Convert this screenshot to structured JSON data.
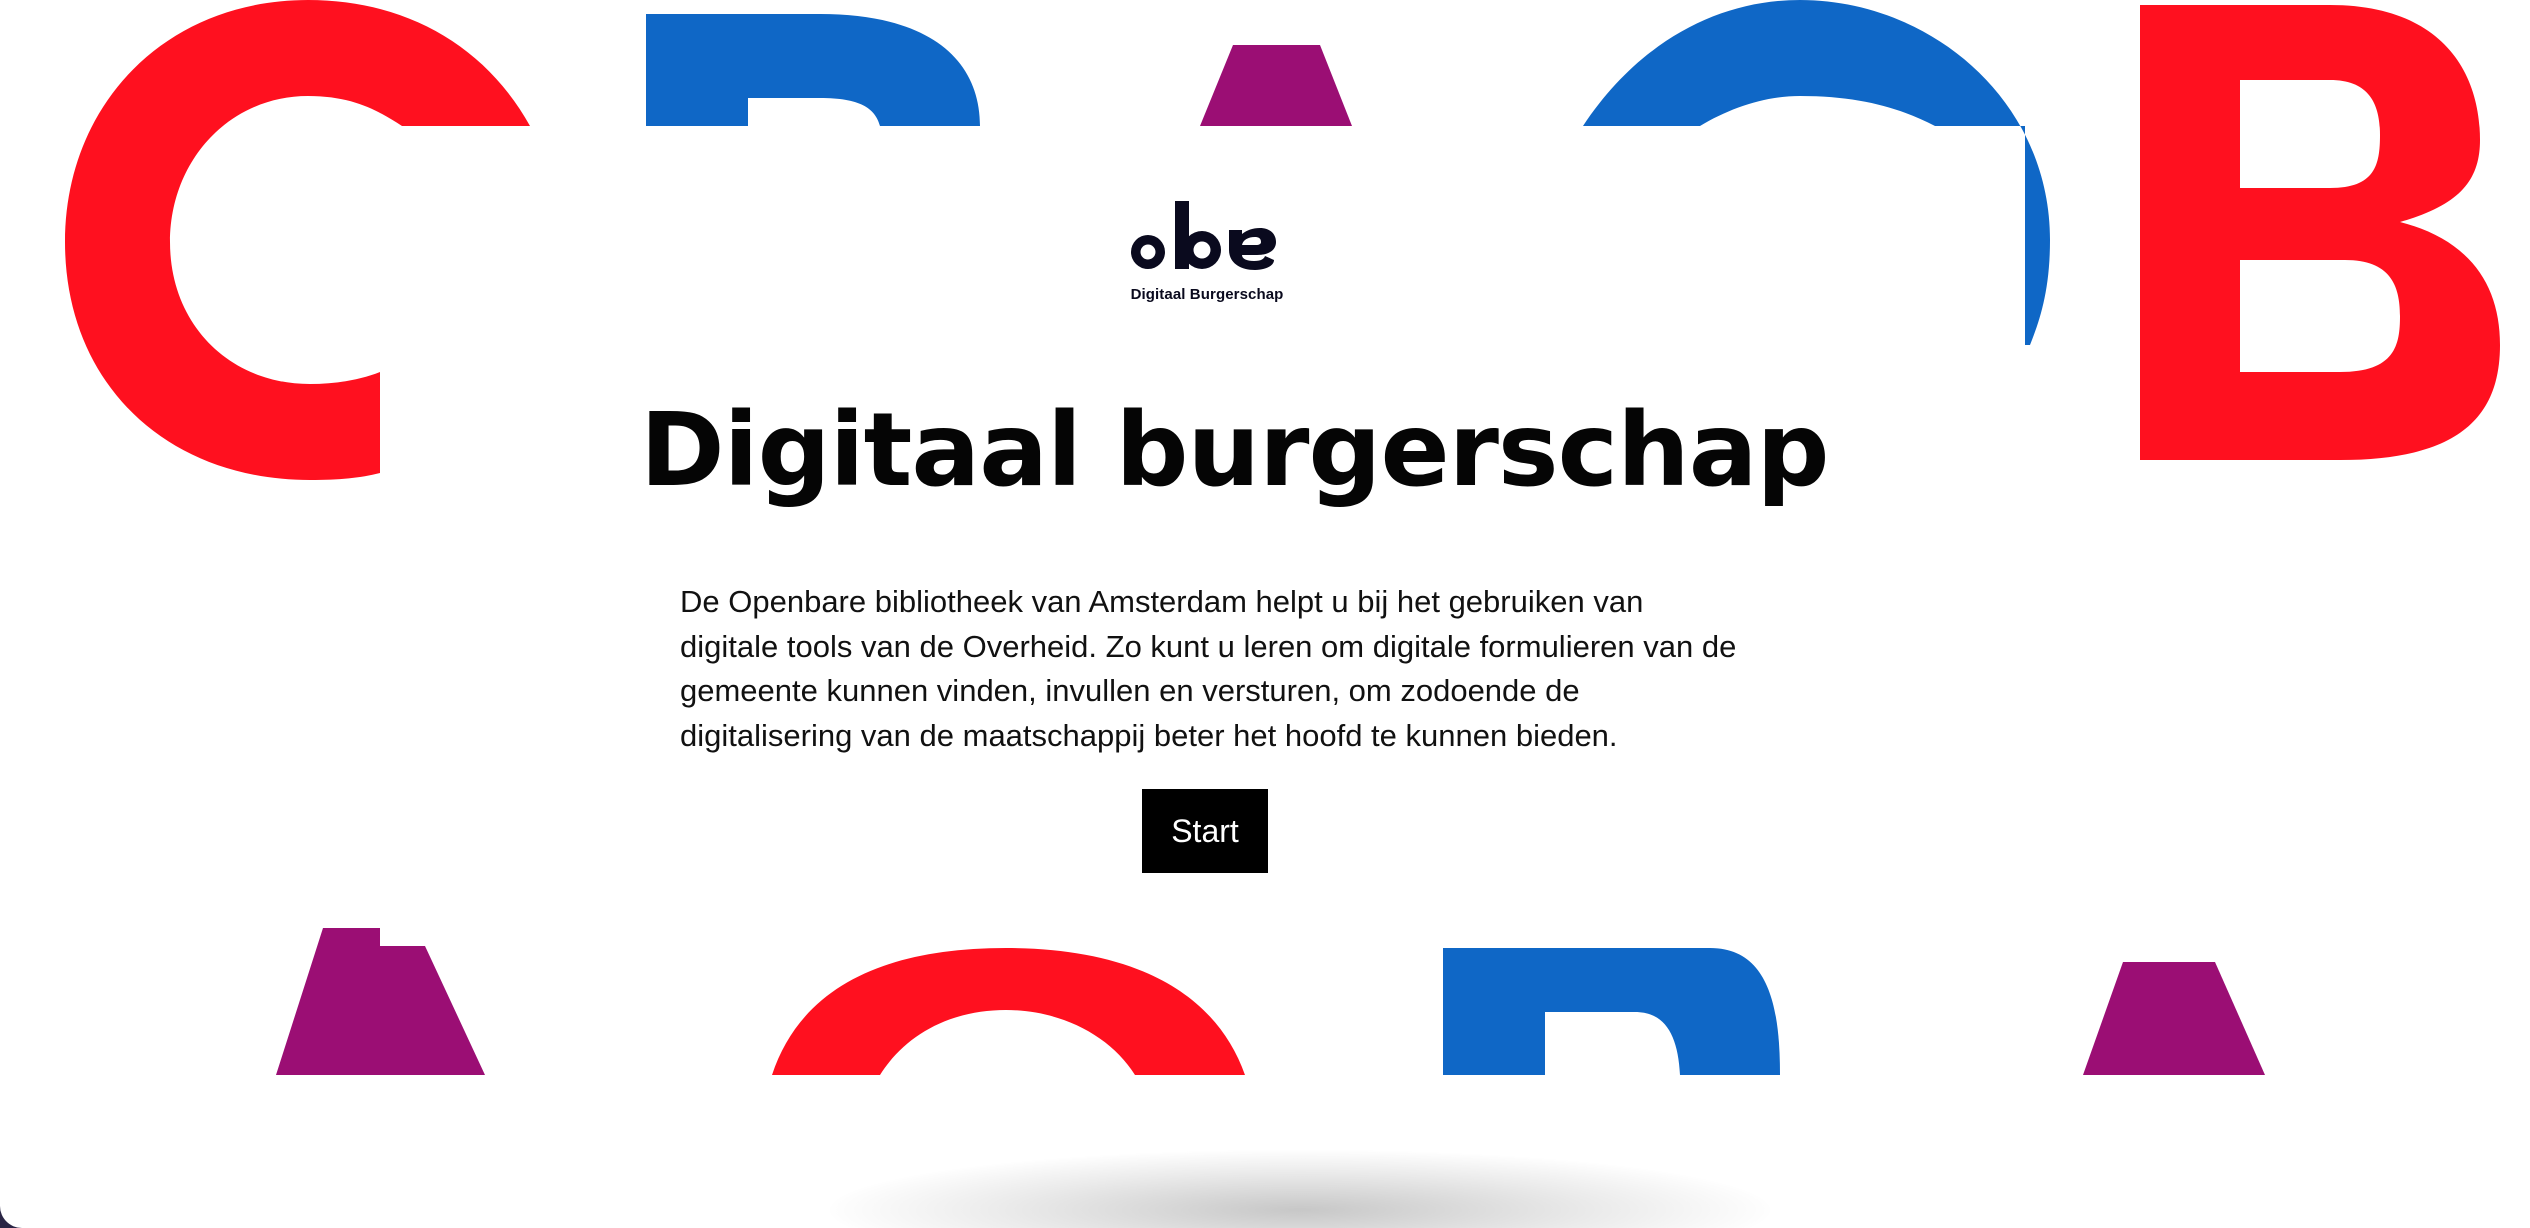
{
  "brand": {
    "logo_text": "oba",
    "logo_subtitle": "Digitaal Burgerschap"
  },
  "hero": {
    "title": "Digitaal burgerschap",
    "description": "De Openbare bibliotheek van Amsterdam helpt u bij het gebruiken van digitale tools van de Overheid. Zo kunt u leren om digitale formulieren van de gemeente kunnen vinden, invullen en versturen, om zodoende de digitalisering van de maatschappij beter het hoofd te kunnen bieden.",
    "start_label": "Start"
  },
  "colors": {
    "red": "#ff101f",
    "blue": "#0f67c6",
    "purple": "#9b0e74",
    "text": "#050505",
    "button_bg": "#000000",
    "button_text": "#ffffff",
    "frame": "#2a2545"
  }
}
